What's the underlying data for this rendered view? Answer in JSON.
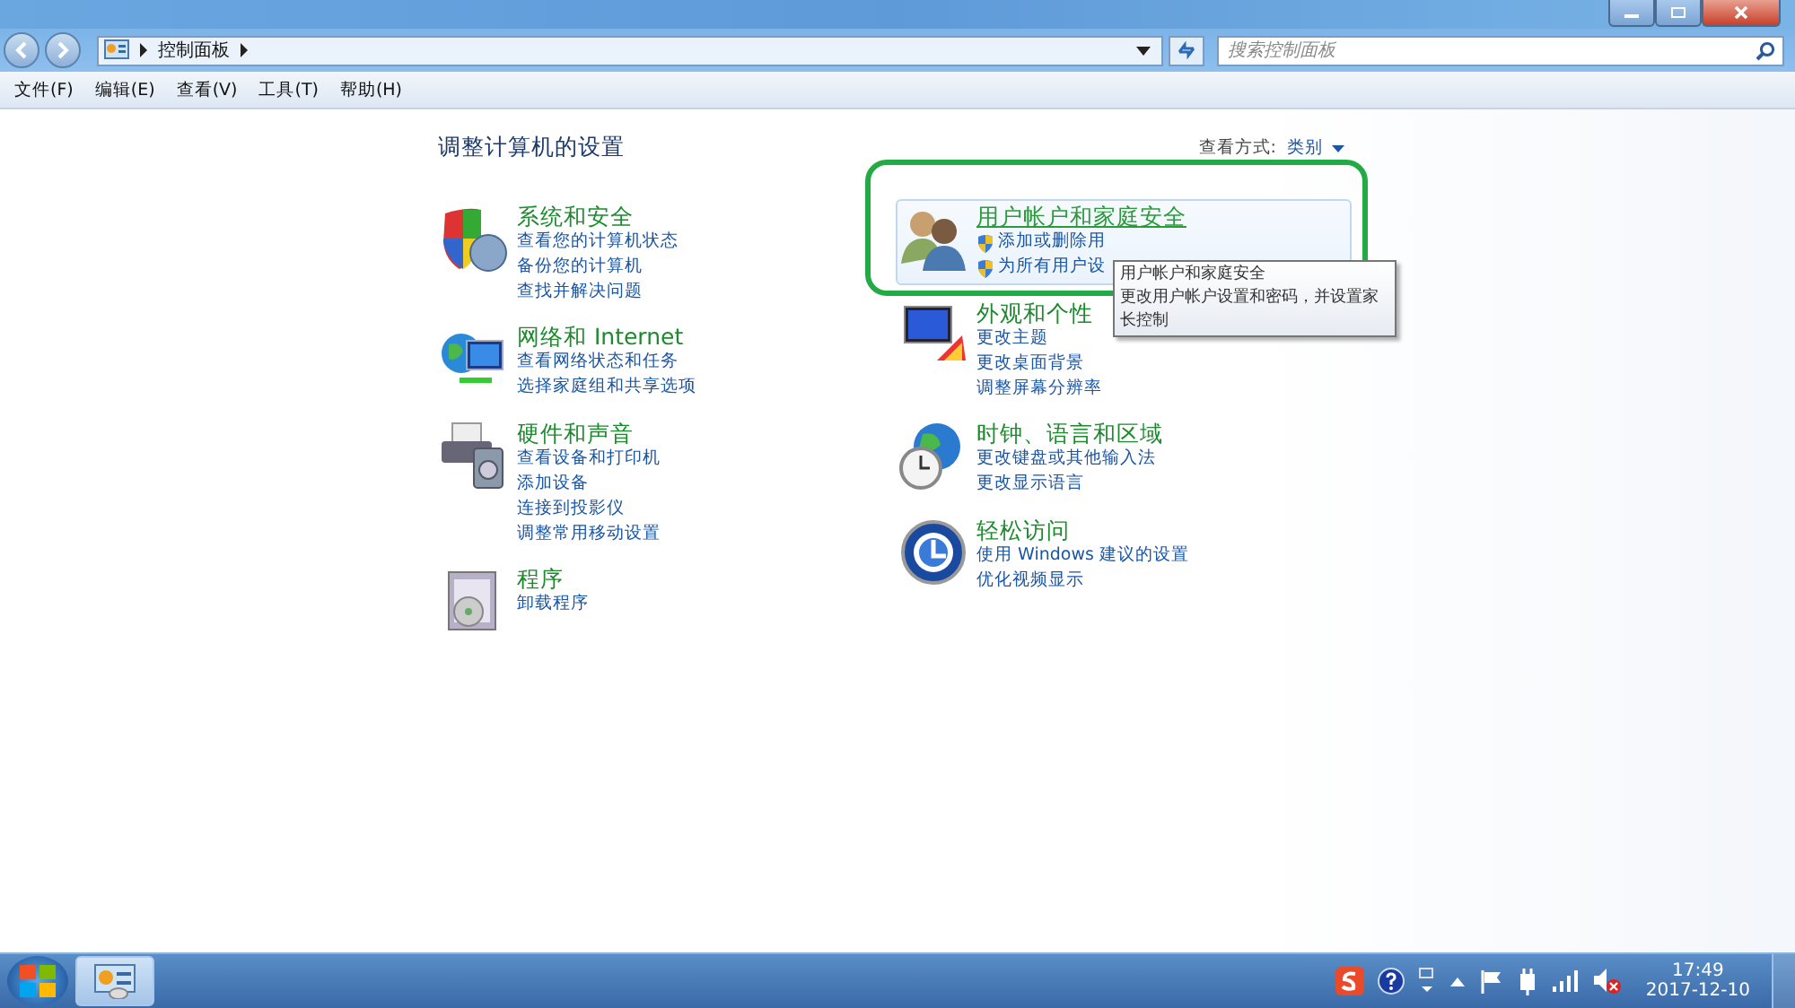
{
  "address_bar": {
    "path": [
      "控制面板"
    ]
  },
  "search": {
    "placeholder": "搜索控制面板"
  },
  "menu": [
    "文件(F)",
    "编辑(E)",
    "查看(V)",
    "工具(T)",
    "帮助(H)"
  ],
  "heading": "调整计算机的设置",
  "view_by": {
    "label": "查看方式:",
    "value": "类别"
  },
  "columns": [
    {
      "categories": [
        {
          "title": "系统和安全",
          "highlighted": false,
          "links": [
            {
              "text": "查看您的计算机状态",
              "shield": false
            },
            {
              "text": "备份您的计算机",
              "shield": false
            },
            {
              "text": "查找并解决问题",
              "shield": false
            }
          ]
        },
        {
          "title": "网络和 Internet",
          "highlighted": false,
          "links": [
            {
              "text": "查看网络状态和任务",
              "shield": false
            },
            {
              "text": "选择家庭组和共享选项",
              "shield": false
            }
          ]
        },
        {
          "title": "硬件和声音",
          "highlighted": false,
          "links": [
            {
              "text": "查看设备和打印机",
              "shield": false
            },
            {
              "text": "添加设备",
              "shield": false
            },
            {
              "text": "连接到投影仪",
              "shield": false
            },
            {
              "text": "调整常用移动设置",
              "shield": false
            }
          ]
        },
        {
          "title": "程序",
          "highlighted": false,
          "links": [
            {
              "text": "卸载程序",
              "shield": false
            }
          ]
        }
      ]
    },
    {
      "categories": [
        {
          "title": "用户帐户和家庭安全",
          "highlighted": true,
          "links": [
            {
              "text": "添加或删除用",
              "shield": true
            },
            {
              "text": "为所有用户设",
              "shield": true
            }
          ]
        },
        {
          "title": "外观和个性",
          "highlighted": false,
          "links": [
            {
              "text": "更改主题",
              "shield": false
            },
            {
              "text": "更改桌面背景",
              "shield": false
            },
            {
              "text": "调整屏幕分辨率",
              "shield": false
            }
          ]
        },
        {
          "title": "时钟、语言和区域",
          "highlighted": false,
          "links": [
            {
              "text": "更改键盘或其他输入法",
              "shield": false
            },
            {
              "text": "更改显示语言",
              "shield": false
            }
          ]
        },
        {
          "title": "轻松访问",
          "highlighted": false,
          "links": [
            {
              "text": "使用 Windows 建议的设置",
              "shield": false
            },
            {
              "text": "优化视频显示",
              "shield": false
            }
          ]
        }
      ]
    }
  ],
  "tooltip": {
    "lines": [
      "用户帐户和家庭安全",
      "更改用户帐户设置和密码，并设置家",
      "长控制"
    ]
  },
  "clock": {
    "time": "17:49",
    "date": "2017-12-10"
  }
}
